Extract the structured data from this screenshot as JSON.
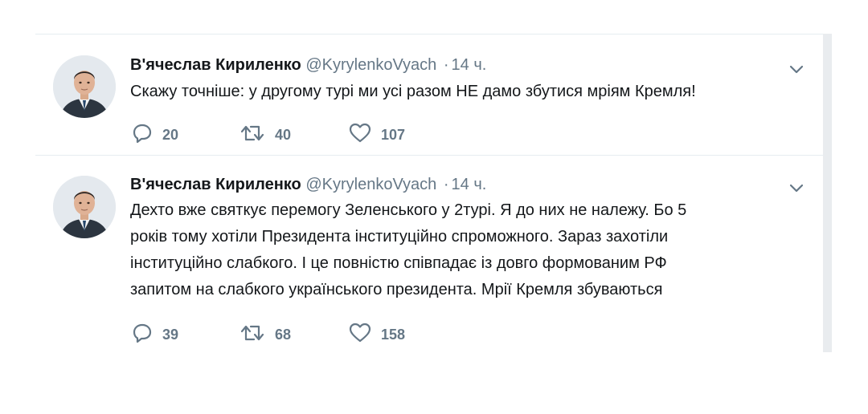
{
  "tweets": [
    {
      "author_name": "В'ячеслав Кириленко",
      "handle": "@KyrylenkoVyach",
      "separator": "·",
      "time": "14 ч.",
      "text_lines": [
        "Скажу точніше: у другому турі ми усі разом НЕ дамо збутися мріям Кремля!"
      ],
      "replies": "20",
      "retweets": "40",
      "likes": "107"
    },
    {
      "author_name": "В'ячеслав Кириленко",
      "handle": "@KyrylenkoVyach",
      "separator": "·",
      "time": "14 ч.",
      "text_lines": [
        "Дехто вже святкує перемогу Зеленського у 2турі. Я до них не належу. Бо 5",
        "років тому хотіли Президента інституційно спроможного. Зараз захотіли",
        "інституційно слабкого. І це повністю співпадає із довго формованим РФ",
        "запитом на слабкого українського президента. Мрії Кремля збуваються"
      ],
      "replies": "39",
      "retweets": "68",
      "likes": "158"
    }
  ],
  "icons": {
    "reply": "reply-icon",
    "retweet": "retweet-icon",
    "like": "heart-icon",
    "caret": "chevron-down-icon",
    "avatar": "avatar"
  },
  "colors": {
    "name": "#14171a",
    "muted": "#657786",
    "divider": "#e6ecf0"
  }
}
